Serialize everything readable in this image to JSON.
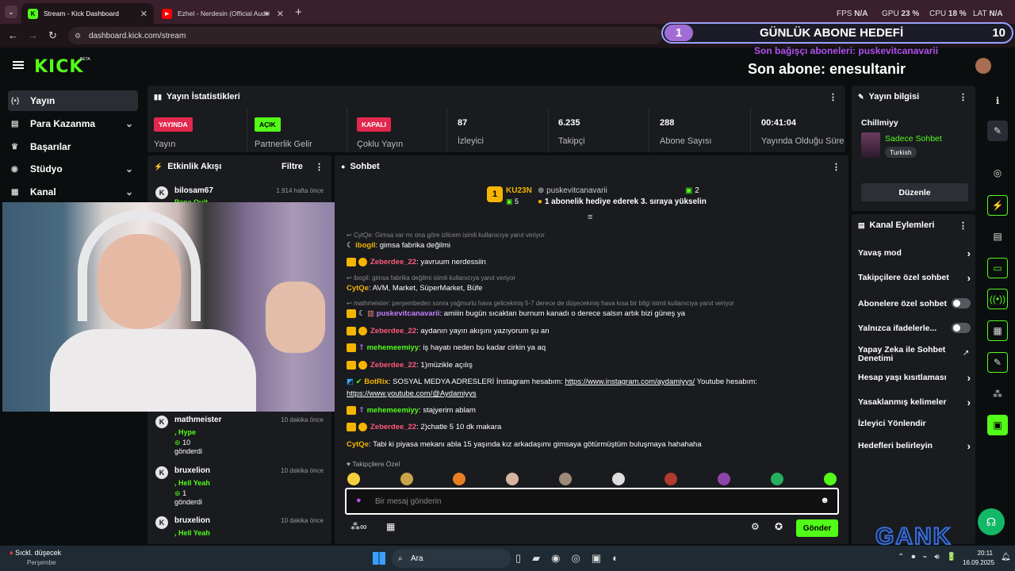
{
  "browser": {
    "tabs": [
      {
        "label": "Stream - Kick Dashboard",
        "favicon": "K"
      },
      {
        "label": "Ezhel - Nerdesin (Official Audi",
        "favicon": "▶"
      }
    ],
    "url": "dashboard.kick.com/stream",
    "stats": {
      "fps_label": "FPS",
      "fps": "N/A",
      "gpu_label": "GPU",
      "gpu": "23 %",
      "cpu_label": "CPU",
      "cpu": "18 %",
      "lat_label": "LAT",
      "lat": "N/A"
    }
  },
  "overlay": {
    "goal_number": "1",
    "goal_title": "GÜNLÜK ABONE HEDEFİ",
    "goal_count": "10",
    "last_gifter": "Son bağışçı aboneleri: puskevitcanavarii",
    "last_sub": "Son abone: enesultanir",
    "watermark": "GANK"
  },
  "topnav": {
    "logo": "KICK",
    "beta": "BETA"
  },
  "sidebar": {
    "items": [
      {
        "label": "Yayın",
        "icon": "stream-icon"
      },
      {
        "label": "Para Kazanma",
        "icon": "money-icon"
      },
      {
        "label": "Başarılar",
        "icon": "trophy-icon"
      },
      {
        "label": "Stüdyo",
        "icon": "studio-icon"
      },
      {
        "label": "Kanal",
        "icon": "channel-icon"
      }
    ]
  },
  "stream_stats": {
    "title": "Yayın İstatistikleri",
    "cells": [
      {
        "badge": "YAYINDA",
        "label": "Yayın",
        "badge_color": "#e2284d"
      },
      {
        "badge": "AÇIK",
        "label": "Partnerlik Gelir",
        "badge_color": "#53fc18"
      },
      {
        "badge": "KAPALI",
        "label": "Çoklu Yayın",
        "badge_color": "#e2284d"
      },
      {
        "value": "87",
        "label": "İzleyici"
      },
      {
        "value": "6.235",
        "label": "Takipçi"
      },
      {
        "value": "288",
        "label": "Abone Sayısı"
      },
      {
        "value": "00:41:04",
        "label": "Yayında Olduğu Süre"
      }
    ]
  },
  "activity": {
    "title": "Etkinlik Akışı",
    "filter": "Filtre",
    "items": [
      {
        "name": "bilosam67",
        "time": "1.914 hafta önce",
        "gift": "Papa Quit",
        "count": "",
        "sent": ""
      },
      {
        "name": "mathmeister",
        "time": "10 dakika önce",
        "gift": ", Hype",
        "count": "10",
        "sent": "gönderdi"
      },
      {
        "name": "bruxelion",
        "time": "10 dakika önce",
        "gift": ", Hell Yeah",
        "count": "1",
        "sent": "gönderdi"
      },
      {
        "name": "bruxelion",
        "time": "10 dakika önce",
        "gift": ", Hell Yeah",
        "count": "",
        "sent": ""
      }
    ]
  },
  "chat": {
    "title": "Sohbet",
    "pinned": {
      "rank": "1",
      "user": "KU23N",
      "user_count": "5",
      "gifter": "puskevitcanavarii",
      "gifter_count": "2",
      "message": "1 abonelik hediye ederek 3. sıraya yükselin"
    },
    "messages": [
      {
        "reply": "CytQe: Gimsa var mı ona göre izlicem isimli kullanıcıya yanıt veriyor",
        "user": "ibogil",
        "color": "#f4b400",
        "text": ": gimsa fabrika değilmi"
      },
      {
        "reply": "",
        "user": "Zeberdee_22",
        "color": "#ff5a7a",
        "text": ": yavruum nerdessiin"
      },
      {
        "reply": "ibogil: gimsa fabrika değilmi isimli kullanıcıya yanıt veriyor",
        "user": "CytQe",
        "color": "#f4b400",
        "text": ": AVM, Market, SüperMarket, Büfe"
      },
      {
        "reply": "mathmeister: perşembeden sonra yağmurlu hava gelicekmiş 5-7 derece de düşecekmiş hava kısa bir bilgi isimli kullanıcıya yanıt veriyor",
        "user": "puskevitcanavarii",
        "color": "#c77dff",
        "text": ": amiiin bugün sıcaktan burnum kanadı o derece salsın artık bizi güneş ya"
      },
      {
        "reply": "",
        "user": "Zeberdee_22",
        "color": "#ff5a7a",
        "text": ": aydanın yayın akışını yazıyorum şu an"
      },
      {
        "reply": "",
        "user": "mehemeemiyy",
        "color": "#53fc18",
        "text": ": iş hayatı neden bu kadar cirkin ya aq"
      },
      {
        "reply": "",
        "user": "Zeberdee_22",
        "color": "#ff5a7a",
        "text": ": 1)müzikle açılış"
      },
      {
        "reply": "",
        "user": "BotRix",
        "color": "#f4b400",
        "text": ": SOSYAL MEDYA ADRESLERİ İnstagram hesabım:",
        "link": "https://www.instagram.com/aydamiyys/",
        "text2": "Youtube hesabım:",
        "link2": "https://www.youtube.com/@Aydamiyys"
      },
      {
        "reply": "",
        "user": "mehemeemiyy",
        "color": "#53fc18",
        "text": ": stajyerim ablam"
      },
      {
        "reply": "",
        "user": "Zeberdee_22",
        "color": "#ff5a7a",
        "text": ": 2)chatle 5 10 dk makara"
      },
      {
        "reply": "",
        "user": "CytQe",
        "color": "#f4b400",
        "text": ": Tabi ki piyasa mekanı abla 15 yaşında kız arkadaşımı gimsaya götürmüştüm buluşmaya hahahaha"
      }
    ],
    "emote_label": "Takipçilere Özel",
    "input_placeholder": "Bir mesaj gönderin",
    "send": "Gönder"
  },
  "stream_info": {
    "title": "Yayın bilgisi",
    "stream_title": "Chillmiyy",
    "category": "Sadece Sohbet",
    "language": "Turkish",
    "edit": "Düzenle"
  },
  "channel_actions": {
    "title": "Kanal Eylemleri",
    "items": [
      {
        "label": "Yavaş mod",
        "control": "chevron"
      },
      {
        "label": "Takipçilere özel sohbet",
        "control": "chevron"
      },
      {
        "label": "Abonelere özel sohbet",
        "control": "toggle"
      },
      {
        "label": "Yalnızca ifadelerle...",
        "control": "toggle"
      },
      {
        "label": "Yapay Zeka ile Sohbet Denetimi",
        "control": "external"
      },
      {
        "label": "Hesap yaşı kısıtlaması",
        "control": "chevron"
      },
      {
        "label": "Yasaklanmış kelimeler",
        "control": "chevron"
      },
      {
        "label": "İzleyici Yönlendir",
        "control": "none"
      },
      {
        "label": "Hedefleri belirleyin",
        "control": "chevron"
      }
    ]
  },
  "taskbar": {
    "weather": "Sıckl. düşecek",
    "weather_day": "Perşembe",
    "search": "Ara",
    "time": "20:11",
    "date": "16.09.2025"
  }
}
